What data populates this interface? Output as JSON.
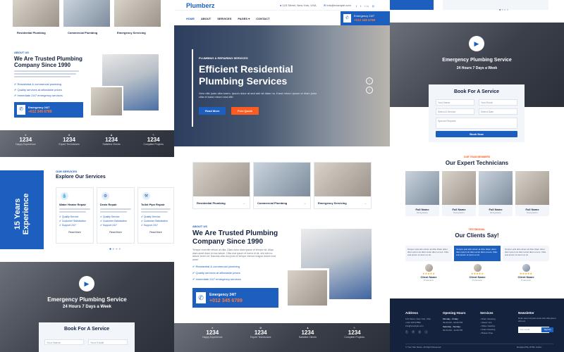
{
  "brand": "Plumberz",
  "topbar": {
    "address": "123 Street, New York, USA",
    "email": "info@example.com",
    "emergency_label": "Emergency 24/7",
    "emergency_phone": "+012 345 6789"
  },
  "nav": {
    "items": [
      "HOME",
      "ABOUT",
      "SERVICES",
      "PAGES ▾",
      "CONTACT"
    ]
  },
  "hero": {
    "eyebrow": "PLUMBING & REPAIRING SERVICES",
    "title_line1": "Efficient Residential",
    "title_line2": "Plumbing Services",
    "body": "Vero elitr justo clita lorem. Ipsum dolor at sed stet sit diam no. Kasd rebum ipsum et diam justo clita et kasd rebum sea elitr.",
    "btn_primary": "Read More",
    "btn_secondary": "Free Quote"
  },
  "service_tiles": [
    {
      "label": "Residential Plumbing",
      "arrow": "→"
    },
    {
      "label": "Commercial Plumbing",
      "arrow": "→"
    },
    {
      "label": "Emergency Servicing",
      "arrow": "→"
    }
  ],
  "about": {
    "eyebrow": "ABOUT US",
    "title_line1": "We Are Trusted Plumbing",
    "title_line2": "Company Since 1990",
    "body": "Tempor erat elitr rebum at clita. Diam dolor diam ipsum et tempor sit. Aliqu diam amet diam et eos labore. Clita erat ipsum et lorem et sit, sed stet no labore lorem sit. Sanctus clita duo justo et tempor eirmod magna dolore erat amet",
    "checks": [
      "Residential & commercial plumbing",
      "Quality services at affordable prices",
      "Immediate 24/7 emergency services"
    ],
    "emergency_label": "Emergency 24/7",
    "emergency_phone": "+012 345 6789"
  },
  "stats": [
    {
      "value": "1234",
      "label": "Happy Experience"
    },
    {
      "value": "1234",
      "label": "Expert Technicians"
    },
    {
      "value": "1234",
      "label": "Satisfied Clients"
    },
    {
      "value": "1234",
      "label": "Complete Projects"
    }
  ],
  "services_section": {
    "eyebrow": "OUR SERVICES",
    "title": "Explore Our Services",
    "side_badge": "15 Years Experience",
    "cards": [
      {
        "title": "Water Heater Repair",
        "button": "Read More"
      },
      {
        "title": "Drain Repair",
        "button": "Read More"
      },
      {
        "title": "Toilet Pipe Repair",
        "button": "Read More"
      }
    ],
    "features": [
      "Quality Service",
      "Customer Satisfaction",
      "Support 24/7"
    ]
  },
  "emergency_banner": {
    "title": "Emergency Plumbing Service",
    "subtitle": "24 Hours 7 Days a Week"
  },
  "booking": {
    "title": "Book For A Service",
    "fields": [
      "Your Name",
      "Your Email",
      "Select A Service",
      "Select Date",
      "Special Request"
    ],
    "button": "Book Now"
  },
  "team": {
    "eyebrow": "OUR TEAM MEMBERS",
    "title": "Our Expert Technicians",
    "members": [
      {
        "name": "Full Name",
        "role": "Designation"
      },
      {
        "name": "Full Name",
        "role": "Designation"
      },
      {
        "name": "Full Name",
        "role": "Designation"
      },
      {
        "name": "Full Name",
        "role": "Designation"
      }
    ]
  },
  "testimonials": {
    "eyebrow": "TESTIMONIAL",
    "title": "Our Clients Say!",
    "quote": "Tempor erat elitr rebum at clita. Diam dolor diam ipsum sit diam amet diam et eos. Clita erat ipsum et lorem et sit.",
    "clients": [
      {
        "name": "Client Name",
        "role": "Profession"
      },
      {
        "name": "Client Name",
        "role": "Profession"
      },
      {
        "name": "Client Name",
        "role": "Profession"
      }
    ],
    "stars": "★★★★★"
  },
  "footer": {
    "columns": [
      "Address",
      "Opening Hours",
      "Services",
      "Newsletter"
    ],
    "address_lines": [
      "123 Street, New York, USA",
      "+012 345 67890",
      "info@example.com"
    ],
    "hours": [
      "Monday - Friday:",
      "09.00 AM - 09.00 PM",
      "Saturday - Sunday:",
      "09.00 AM - 12.00 PM"
    ],
    "services": [
      "Drain Cleaning",
      "Sewer Line",
      "Water Heating",
      "Toilet Cleaning",
      "Broken Pipe"
    ],
    "newsletter_text": "Dolor amet sit justo amet elitr clita ipsum elitr est.",
    "newsletter_placeholder": "Your email",
    "newsletter_button": "SignUp",
    "copyright": "© Your Site Name, All Right Reserved.",
    "designed_by": "Designed By HTML Codex"
  },
  "colors": {
    "primary": "#1d5fbf",
    "accent": "#ff5a1f",
    "dark": "#14223e"
  }
}
